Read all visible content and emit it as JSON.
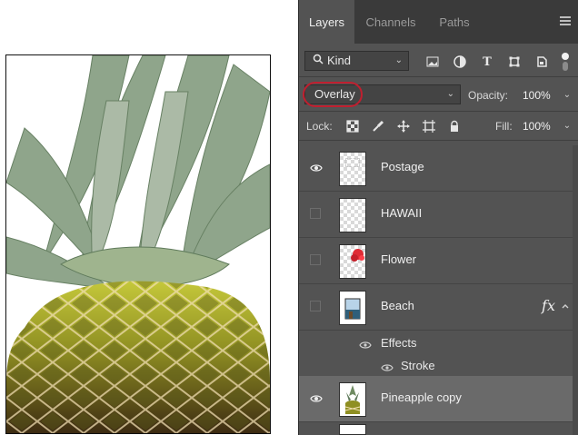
{
  "panel": {
    "tabs": [
      {
        "label": "Layers",
        "active": true
      },
      {
        "label": "Channels",
        "active": false
      },
      {
        "label": "Paths",
        "active": false
      }
    ],
    "filter": {
      "kind_label": "Kind"
    },
    "blend": {
      "mode": "Overlay",
      "opacity_label": "Opacity:",
      "opacity_value": "100%"
    },
    "lock": {
      "label": "Lock:",
      "fill_label": "Fill:",
      "fill_value": "100%"
    },
    "layers": [
      {
        "name": "Postage",
        "visible": true,
        "selected": false,
        "thumb": "transparent"
      },
      {
        "name": "HAWAII",
        "visible": false,
        "selected": false,
        "thumb": "transparent"
      },
      {
        "name": "Flower",
        "visible": false,
        "selected": false,
        "thumb": "flower"
      },
      {
        "name": "Beach",
        "visible": false,
        "selected": false,
        "thumb": "beach",
        "fx": "fx"
      },
      {
        "name": "Pineapple copy",
        "visible": true,
        "selected": true,
        "thumb": "pineapple"
      }
    ],
    "beach_effects": {
      "effects_label": "Effects",
      "stroke_label": "Stroke"
    }
  },
  "colors": {
    "panel_bg": "#535353",
    "tabs_bg": "#3a3a3a",
    "highlight_ring": "#c01f2f",
    "selected_row": "#6a6a6a"
  },
  "icons": {
    "search": "search-icon",
    "image_filter": "image-filter-icon",
    "adjustment_filter": "adjustment-filter-icon",
    "type_filter": "type-filter-icon",
    "shape_filter": "shape-filter-icon",
    "smart_object_filter": "smart-object-filter-icon",
    "lock_transparent": "lock-transparent-pixels-icon",
    "lock_image": "lock-image-pixels-icon",
    "lock_position": "lock-position-icon",
    "lock_artboard": "lock-artboard-icon",
    "lock_all": "lock-all-icon",
    "eye": "eye-icon",
    "fx": "fx-icon"
  }
}
